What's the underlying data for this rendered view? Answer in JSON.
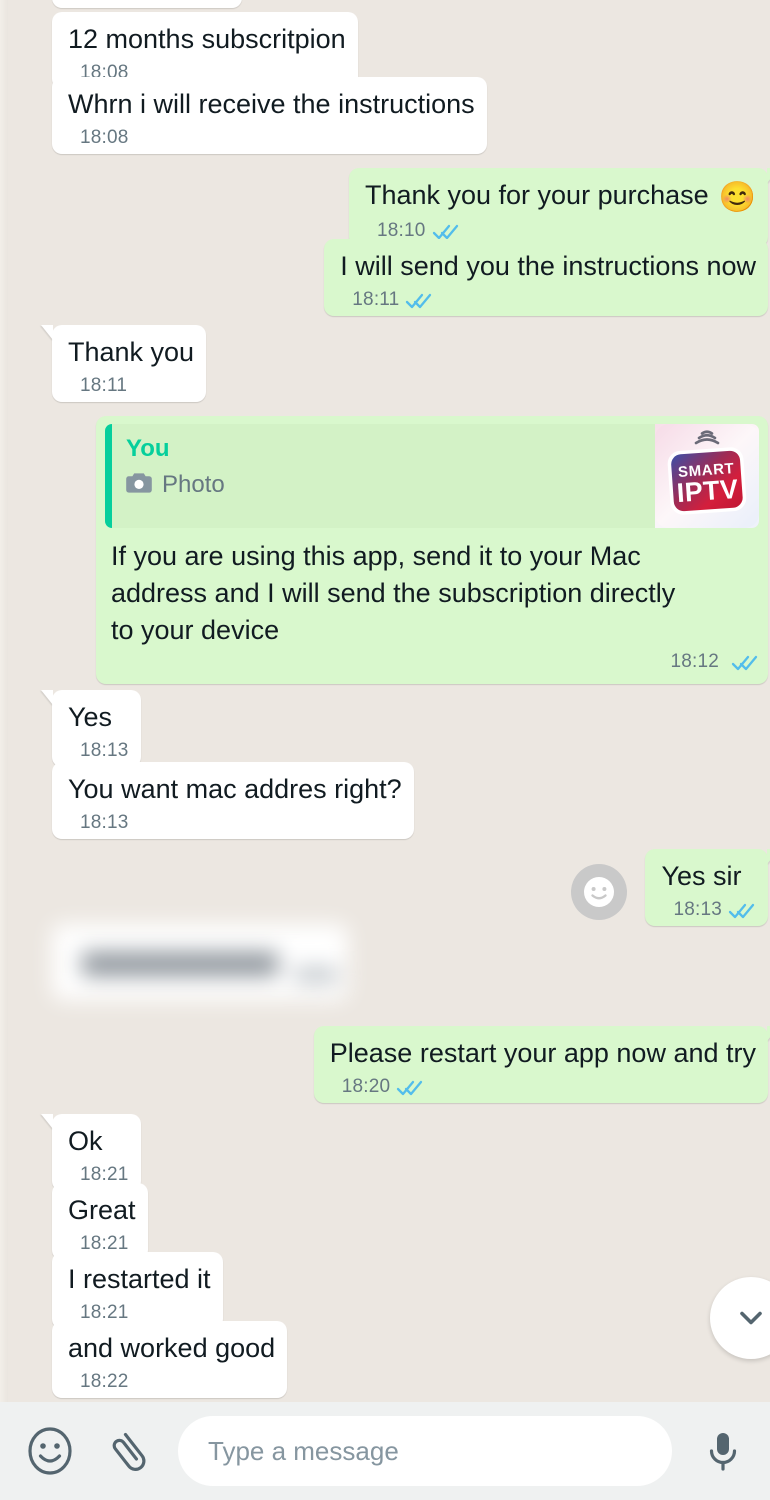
{
  "app": {
    "name": "WhatsApp Chat",
    "background_color": "#ece7e1",
    "incoming_bubble_color": "#ffffff",
    "outgoing_bubble_color": "#d9f8cd",
    "tick_color": "#53bdeb",
    "quote_accent_color": "#06cf9c",
    "time_color": "#667781"
  },
  "messages": [
    {
      "id": "m1",
      "side": "incoming",
      "text": "12 months subscritpion",
      "time": "18:08",
      "status": "",
      "tail": false
    },
    {
      "id": "m2",
      "side": "incoming",
      "text": "Whrn i will receive the instructions",
      "time": "18:08",
      "status": "",
      "tail": false
    },
    {
      "id": "m3",
      "side": "outgoing",
      "text": "Thank you for your purchase",
      "emoji": "😊",
      "time": "18:10",
      "status": "read",
      "tail": true
    },
    {
      "id": "m4",
      "side": "outgoing",
      "text": "I will send you the instructions now",
      "time": "18:11",
      "status": "read",
      "tail": false
    },
    {
      "id": "m5",
      "side": "incoming",
      "text": "Thank you",
      "time": "18:11",
      "status": "",
      "tail": true
    },
    {
      "id": "m6",
      "side": "outgoing",
      "type": "quoted",
      "quote": {
        "author": "You",
        "attachment_label": "Photo",
        "attachment_icon": "camera-icon",
        "thumbnail_title_top": "Smart",
        "thumbnail_title_bottom": "IPTV"
      },
      "line1": "If you are using this app, send it to your Mac",
      "line2": "address and I will send the subscription directly",
      "line3": "to your device",
      "time": "18:12",
      "status": "read",
      "tail": false
    },
    {
      "id": "m7",
      "side": "incoming",
      "text": "Yes",
      "time": "18:13",
      "status": "",
      "tail": true
    },
    {
      "id": "m8",
      "side": "incoming",
      "text": "You want mac addres right?",
      "time": "18:13",
      "status": "",
      "tail": false
    },
    {
      "id": "m9",
      "side": "outgoing",
      "text": "Yes sir",
      "time": "18:13",
      "status": "read",
      "tail": true,
      "reaction_button": "smiley-face"
    },
    {
      "id": "m10",
      "side": "incoming",
      "type": "blurred",
      "text": "",
      "time": "",
      "status": "",
      "note": "blurred"
    },
    {
      "id": "m11",
      "side": "outgoing",
      "text": "Please restart your app now and try",
      "time": "18:20",
      "status": "read",
      "tail": true
    },
    {
      "id": "m12",
      "side": "incoming",
      "text": "Ok",
      "time": "18:21",
      "status": "",
      "tail": true
    },
    {
      "id": "m13",
      "side": "incoming",
      "text": "Great",
      "time": "18:21",
      "status": "",
      "tail": false
    },
    {
      "id": "m14",
      "side": "incoming",
      "text": "I restarted it",
      "time": "18:21",
      "status": "",
      "tail": false
    },
    {
      "id": "m15",
      "side": "incoming",
      "text": "and worked good",
      "time": "18:22",
      "status": "",
      "tail": false
    }
  ],
  "scroll_button": {
    "icon": "chevron-down-icon"
  },
  "composer": {
    "emoji_icon": "smiley-icon",
    "attach_icon": "paperclip-icon",
    "placeholder": "Type a message",
    "value": "",
    "mic_icon": "microphone-icon"
  }
}
